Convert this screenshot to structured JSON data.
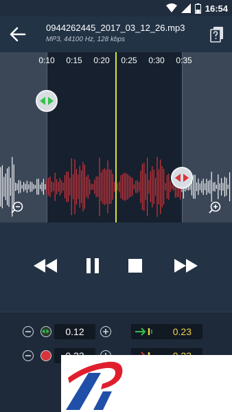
{
  "status_bar": {
    "time": "16:54",
    "icons": [
      "wifi-icon",
      "signal-icon",
      "battery-icon"
    ]
  },
  "app_bar": {
    "title": "0944262445_2017_03_12_26.mp3",
    "subtitle": "MP3, 44100 Hz, 128 kbps",
    "back_icon": "arrow-left-icon",
    "action_icon": "file-help-icon"
  },
  "timeline": {
    "ticks": [
      "0:10",
      "0:15",
      "0:20",
      "0:25",
      "0:30",
      "0:35"
    ]
  },
  "controls": {
    "start_value": "0.12",
    "fade_in_value": "0.23",
    "end_value": "0.23",
    "fade_out_value": "0.23"
  },
  "colors": {
    "waveform_selected": "#d8343b",
    "waveform_unselected": "#f2f4f6",
    "playhead": "#d9e33b",
    "start_marker": "#34c24a",
    "end_marker": "#d8343b",
    "fade_value": "#f0d64a",
    "logo_red": "#e01f2d",
    "logo_blue": "#1f4fa8"
  }
}
